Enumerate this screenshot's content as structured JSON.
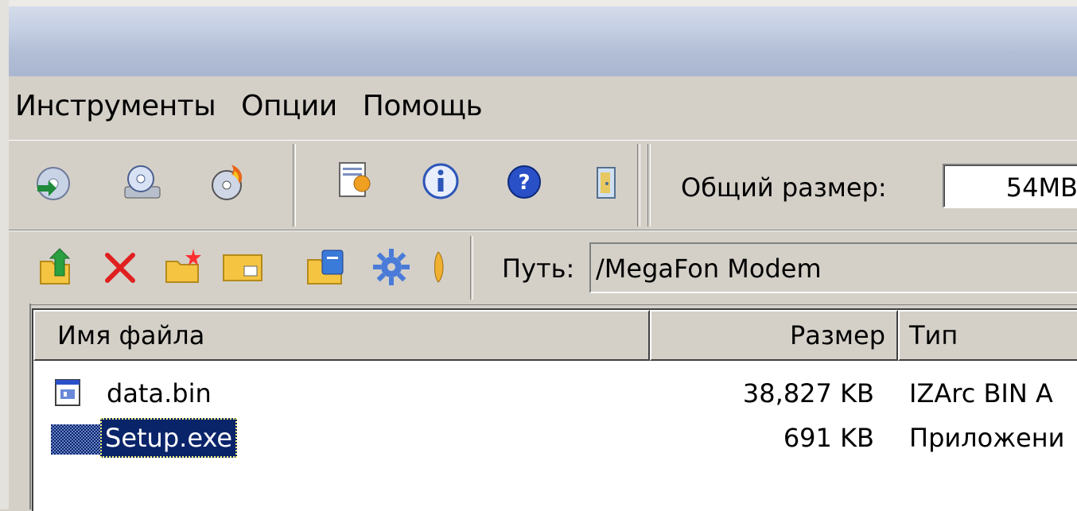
{
  "menu": {
    "items": [
      {
        "label": "Инструменты"
      },
      {
        "label": "Опции"
      },
      {
        "label": "Помощь"
      }
    ]
  },
  "toolbar_top": {
    "icons": [
      "cd-convert-icon",
      "disk-scan-icon",
      "burn-cd-icon",
      "edit-page-icon",
      "info-icon",
      "help-icon",
      "exit-door-icon"
    ],
    "total_size_label": "Общий размер:",
    "total_size_value": "54MB"
  },
  "toolbar_path": {
    "icons": [
      "folder-up-icon",
      "delete-icon",
      "new-folder-icon",
      "rename-icon",
      "extract-icon",
      "settings-gear-icon",
      "partial-icon"
    ],
    "path_label": "Путь:",
    "path_value": "/MegaFon Modem"
  },
  "file_list": {
    "columns": [
      "Имя файла",
      "Размер",
      "Тип"
    ],
    "rows": [
      {
        "name": "data.bin",
        "size": "38,827 KB",
        "type": "IZArc BIN A",
        "icon": "archive-file-icon",
        "selected": false
      },
      {
        "name": "Setup.exe",
        "size": "691 KB",
        "type": "Приложени",
        "icon": "exe-file-icon",
        "selected": true
      }
    ]
  },
  "colors": {
    "face": "#d4d0c8",
    "selection": "#0a246a",
    "delete_red": "#e02020"
  }
}
